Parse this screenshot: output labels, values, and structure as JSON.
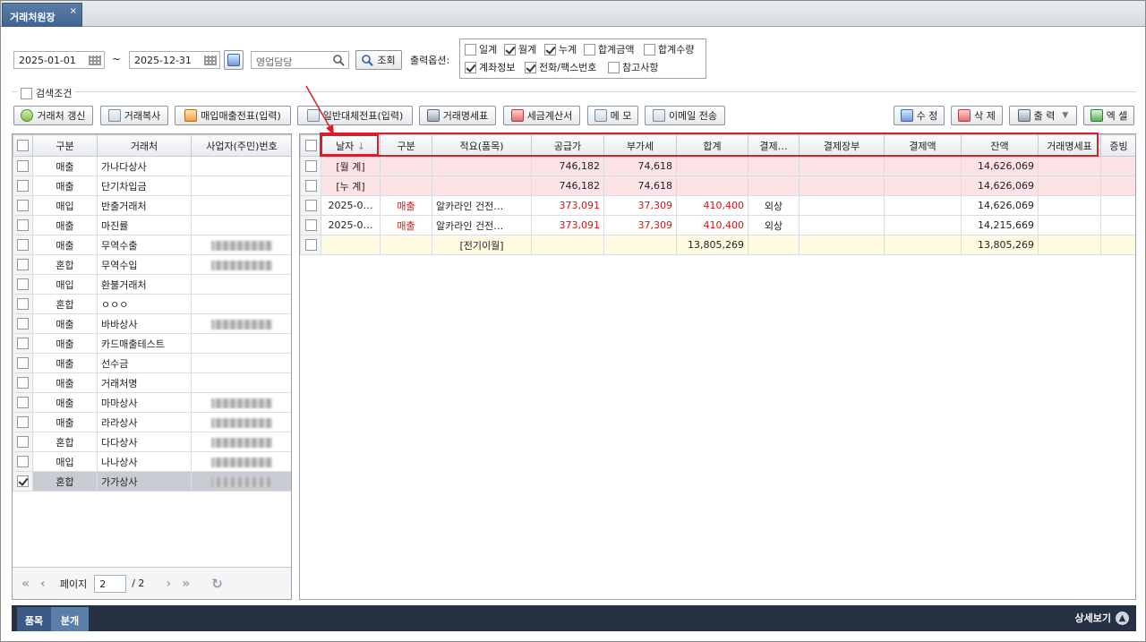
{
  "tab": {
    "title": "거래처원장",
    "close": "×"
  },
  "search": {
    "date_from": "2025-01-01",
    "tilde": "~",
    "date_to": "2025-12-31",
    "manager_placeholder": "영업담당",
    "query_label": "조회",
    "output_options_label": "출력옵션:"
  },
  "output_options": [
    {
      "label": "일계",
      "checked": false
    },
    {
      "label": "월계",
      "checked": true
    },
    {
      "label": "누계",
      "checked": true
    },
    {
      "label": "합계금액",
      "checked": false
    },
    {
      "label": "합계수량",
      "checked": false
    },
    {
      "label": "계좌정보",
      "checked": true
    },
    {
      "label": "전화/팩스번호",
      "checked": true
    },
    {
      "label": "참고사항",
      "checked": false
    }
  ],
  "search_condition_label": "검색조건",
  "toolbar": {
    "refresh": "거래처 갱신",
    "copy": "거래복사",
    "purchase_sales": "매입매출전표(입력)",
    "general_transfer": "일반대체전표(입력)",
    "statement": "거래명세표",
    "tax_invoice": "세금계산서",
    "memo": "메 모",
    "email": "이메일 전송",
    "edit": "수 정",
    "delete": "삭 제",
    "print": "출 력",
    "excel": "엑 셀"
  },
  "left_grid": {
    "headers": [
      "구분",
      "거래처",
      "사업자(주민)번호"
    ],
    "rows": [
      {
        "type": "매출",
        "name": "가나다상사",
        "bizno": "",
        "masked": false,
        "checked": false
      },
      {
        "type": "매출",
        "name": "단기차입금",
        "bizno": "",
        "masked": false,
        "checked": false
      },
      {
        "type": "매입",
        "name": "반출거래처",
        "bizno": "",
        "masked": false,
        "checked": false
      },
      {
        "type": "매출",
        "name": "마진률",
        "bizno": "",
        "masked": false,
        "checked": false
      },
      {
        "type": "매출",
        "name": "무역수출",
        "bizno": "",
        "masked": true,
        "checked": false
      },
      {
        "type": "혼합",
        "name": "무역수입",
        "bizno": "",
        "masked": true,
        "checked": false
      },
      {
        "type": "매입",
        "name": "환불거래처",
        "bizno": "",
        "masked": false,
        "checked": false
      },
      {
        "type": "혼합",
        "name": "ㅇㅇㅇ",
        "bizno": "",
        "masked": false,
        "checked": false
      },
      {
        "type": "매출",
        "name": "바바상사",
        "bizno": "",
        "masked": true,
        "checked": false
      },
      {
        "type": "매출",
        "name": "카드매출테스트",
        "bizno": "",
        "masked": false,
        "checked": false
      },
      {
        "type": "매출",
        "name": "선수금",
        "bizno": "",
        "masked": false,
        "checked": false
      },
      {
        "type": "매출",
        "name": "거래처명",
        "bizno": "",
        "masked": false,
        "checked": false
      },
      {
        "type": "매출",
        "name": "마마상사",
        "bizno": "",
        "masked": true,
        "checked": false
      },
      {
        "type": "매출",
        "name": "라라상사",
        "bizno": "",
        "masked": true,
        "checked": false
      },
      {
        "type": "혼합",
        "name": "다다상사",
        "bizno": "",
        "masked": true,
        "checked": false
      },
      {
        "type": "매입",
        "name": "나나상사",
        "bizno": "",
        "masked": true,
        "checked": false
      },
      {
        "type": "혼합",
        "name": "가가상사",
        "bizno": "",
        "masked": true,
        "checked": true
      }
    ]
  },
  "pager": {
    "label": "페이지",
    "current": "2",
    "total": "/ 2"
  },
  "right_grid": {
    "headers": [
      "날자",
      "구분",
      "적요(품목)",
      "공급가",
      "부가세",
      "합계",
      "결제…",
      "결제장부",
      "결제액",
      "잔액",
      "거래명세표",
      "증빙"
    ],
    "sort_icon": "↓",
    "rows": [
      {
        "style": "pink",
        "cells": [
          "[월 계]",
          "",
          "",
          "746,182",
          "74,618",
          "",
          "",
          "",
          "",
          "14,626,069",
          "",
          ""
        ],
        "red": false
      },
      {
        "style": "pink",
        "cells": [
          "[누 계]",
          "",
          "",
          "746,182",
          "74,618",
          "",
          "",
          "",
          "",
          "14,626,069",
          "",
          ""
        ],
        "red": false
      },
      {
        "style": "white",
        "cells": [
          "2025-0…",
          "매출",
          "알카라인 건전…",
          "373,091",
          "37,309",
          "410,400",
          "외상",
          "",
          "",
          "14,626,069",
          "",
          ""
        ],
        "red": true
      },
      {
        "style": "white",
        "cells": [
          "2025-0…",
          "매출",
          "알카라인 건전…",
          "373,091",
          "37,309",
          "410,400",
          "외상",
          "",
          "",
          "14,215,669",
          "",
          ""
        ],
        "red": true
      },
      {
        "style": "yellow",
        "cells": [
          "",
          "",
          "[전기이월]",
          "",
          "",
          "13,805,269",
          "",
          "",
          "",
          "13,805,269",
          "",
          ""
        ],
        "red": false
      }
    ]
  },
  "bottom": {
    "tab1": "품목",
    "tab2": "분개",
    "detail": "상세보기"
  },
  "colors": {
    "accent_red": "#d9202a",
    "pink_row": "#fde3e6",
    "yellow_row": "#fffbe0",
    "status_bar": "#263244"
  }
}
